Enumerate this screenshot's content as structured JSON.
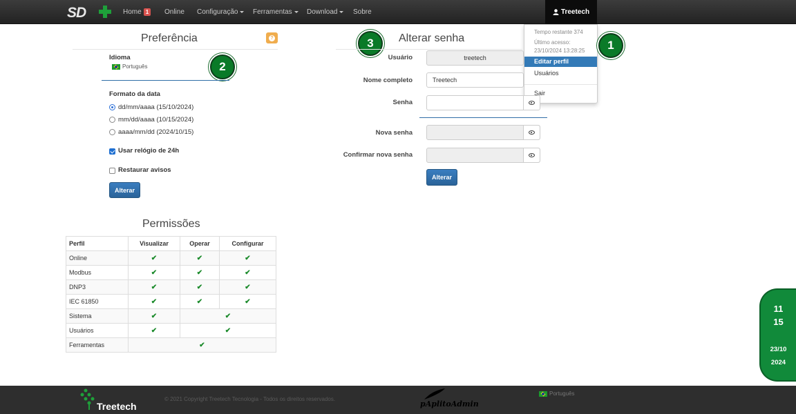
{
  "nav": {
    "home": "Home",
    "home_badge": "1",
    "online": "Online",
    "configuracao": "Configuração",
    "ferramentas": "Ferramentas",
    "download": "Download",
    "sobre": "Sobre",
    "user": "Treetech"
  },
  "user_menu": {
    "time_remaining": "Tempo restante 374",
    "last_access_label": "Último acesso:",
    "last_access": "23/10/2024 13:28:25",
    "edit_profile": "Editar perfil",
    "users": "Usuários",
    "logout": "Sair"
  },
  "steps": [
    "1",
    "2",
    "3"
  ],
  "preferences": {
    "title": "Preferência",
    "language_label": "Idioma",
    "language": "Português",
    "date_format_label": "Formato da data",
    "date_formats": [
      "dd/mm/aaaa (15/10/2024)",
      "mm/dd/aaaa (10/15/2024)",
      "aaaa/mm/dd (2024/10/15)"
    ],
    "selected_date_format": 0,
    "clock24_label": "Usar relógio de 24h",
    "clock24": true,
    "restore_label": "Restaurar avisos",
    "restore": false,
    "submit": "Alterar"
  },
  "change_password": {
    "title": "Alterar senha",
    "username_label": "Usuário",
    "username": "treetech",
    "fullname_label": "Nome completo",
    "fullname": "Treetech",
    "password_label": "Senha",
    "new_password_label": "Nova senha",
    "confirm_password_label": "Confirmar nova senha",
    "submit": "Alterar"
  },
  "permissions": {
    "title": "Permissões",
    "headers": [
      "Perfil",
      "Visualizar",
      "Operar",
      "Configurar"
    ],
    "check": "✔",
    "rows": [
      "Online",
      "Modbus",
      "DNP3",
      "IEC 61850",
      "Sistema",
      "Usuários",
      "Ferramentas"
    ]
  },
  "footer": {
    "brand": "Treetech",
    "copyright": "© 2021 Copyright Treetech Tecnologia - Todos os direitos reservados.",
    "admin": "pAplitoAdmin",
    "language": "Português"
  },
  "clock": {
    "hour": "11",
    "minute": "15",
    "date": "23/10",
    "year": "2024"
  },
  "colors": {
    "navbar": "#222222",
    "primary": "#2f6da6",
    "step_green": "#0a7a28",
    "check_green": "#1a8a2a",
    "help_orange": "#f0ad4e"
  }
}
